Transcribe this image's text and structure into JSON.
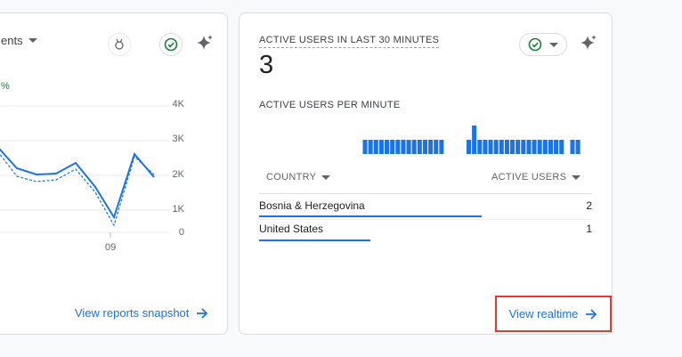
{
  "left_card": {
    "metric_label": "ents",
    "change_text": "%",
    "y_ticks": [
      "4K",
      "3K",
      "2K",
      "1K",
      "0"
    ],
    "x_ticks": [
      "09"
    ],
    "link_label": "View reports snapshot",
    "series": [
      {
        "name": "",
        "style": "solid",
        "color": "#1a73e8"
      },
      {
        "name": "",
        "style": "dashed",
        "color": "#1a73e8"
      }
    ]
  },
  "realtime_card": {
    "title": "ACTIVE USERS IN LAST 30 MINUTES",
    "value": "3",
    "per_minute_label": "ACTIVE USERS PER MINUTE",
    "per_minute_values": [
      0,
      0,
      0,
      0,
      0,
      0,
      0,
      0,
      0,
      0,
      0,
      0,
      0,
      0,
      0,
      0,
      0,
      0,
      0,
      1,
      1,
      1,
      1,
      1,
      1,
      1,
      1,
      1,
      1,
      1,
      1,
      1,
      1,
      1,
      0,
      0,
      0,
      0,
      1,
      2,
      1,
      1,
      1,
      1,
      1,
      1,
      1,
      1,
      1,
      1,
      1,
      1,
      1,
      1,
      1,
      1,
      0,
      1,
      1,
      0,
      0
    ],
    "table": {
      "col_country": "COUNTRY",
      "col_users": "ACTIVE USERS",
      "rows": [
        {
          "country": "Bosnia & Herzegovina",
          "users": "2",
          "share": 1.0
        },
        {
          "country": "United States",
          "users": "1",
          "share": 0.5
        }
      ]
    },
    "link_label": "View realtime"
  },
  "colors": {
    "accent": "#1a73e8",
    "highlight_border": "#e53935",
    "check_green": "#188038"
  }
}
